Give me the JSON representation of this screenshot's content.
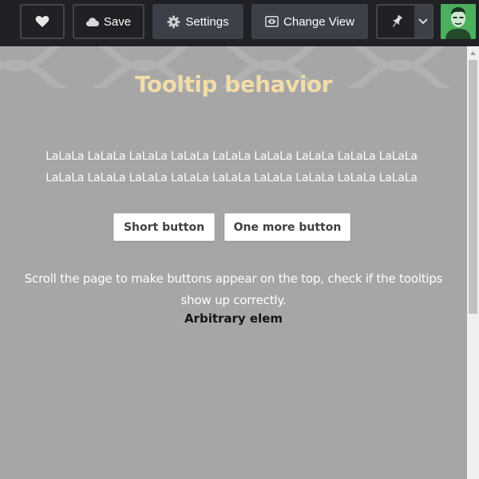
{
  "toolbar": {
    "like_icon": "heart-icon",
    "save_label": "Save",
    "save_icon": "cloud-icon",
    "settings_label": "Settings",
    "settings_icon": "gear-icon",
    "change_view_label": "Change View",
    "change_view_icon": "eye-icon",
    "pin_icon": "pin-icon",
    "dropdown_icon": "chevron-down-icon",
    "avatar_icon": "user-avatar"
  },
  "page": {
    "title": "Tooltip behavior",
    "lala_line1": "LaLaLa LaLaLa LaLaLa LaLaLa LaLaLa LaLaLa LaLaLa LaLaLa LaLaLa",
    "lala_line2": "LaLaLa LaLaLa LaLaLa LaLaLa LaLaLa LaLaLa LaLaLa LaLaLa LaLaLa",
    "short_button": "Short button",
    "more_button": "One more button",
    "instructions": "Scroll the page to make buttons appear on the top, check if the tooltips show up correctly.",
    "arbitrary": "Arbitrary elem"
  },
  "colors": {
    "toolbar_bg": "#1f2124",
    "button_filled": "#3d4049",
    "content_bg": "#a6a6a6",
    "title": "#f2dca8",
    "avatar_bg": "#4caf5e"
  }
}
